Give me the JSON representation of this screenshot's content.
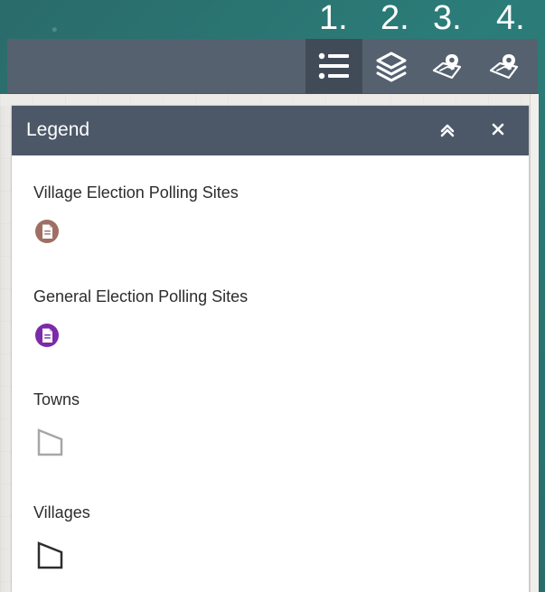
{
  "annotations": {
    "numbers": [
      "1.",
      "2.",
      "3.",
      "4."
    ]
  },
  "toolbar": {
    "buttons": [
      {
        "name": "legend-list-button",
        "icon": "list-icon"
      },
      {
        "name": "layers-button",
        "icon": "layers-icon"
      },
      {
        "name": "map-pin-tool-button",
        "icon": "map-pin-icon"
      },
      {
        "name": "map-pin-tool-button-2",
        "icon": "map-pin-icon"
      }
    ]
  },
  "legend": {
    "title": "Legend",
    "items": [
      {
        "label": "Village Election Polling Sites",
        "icon": "document-icon",
        "color": "#9f6f64"
      },
      {
        "label": "General Election Polling Sites",
        "icon": "document-icon",
        "color": "#7b2aa8"
      },
      {
        "label": "Towns",
        "icon": "polygon-icon",
        "color": "#a7a7a7"
      },
      {
        "label": "Villages",
        "icon": "polygon-icon",
        "color": "#2d2d2d"
      }
    ]
  }
}
